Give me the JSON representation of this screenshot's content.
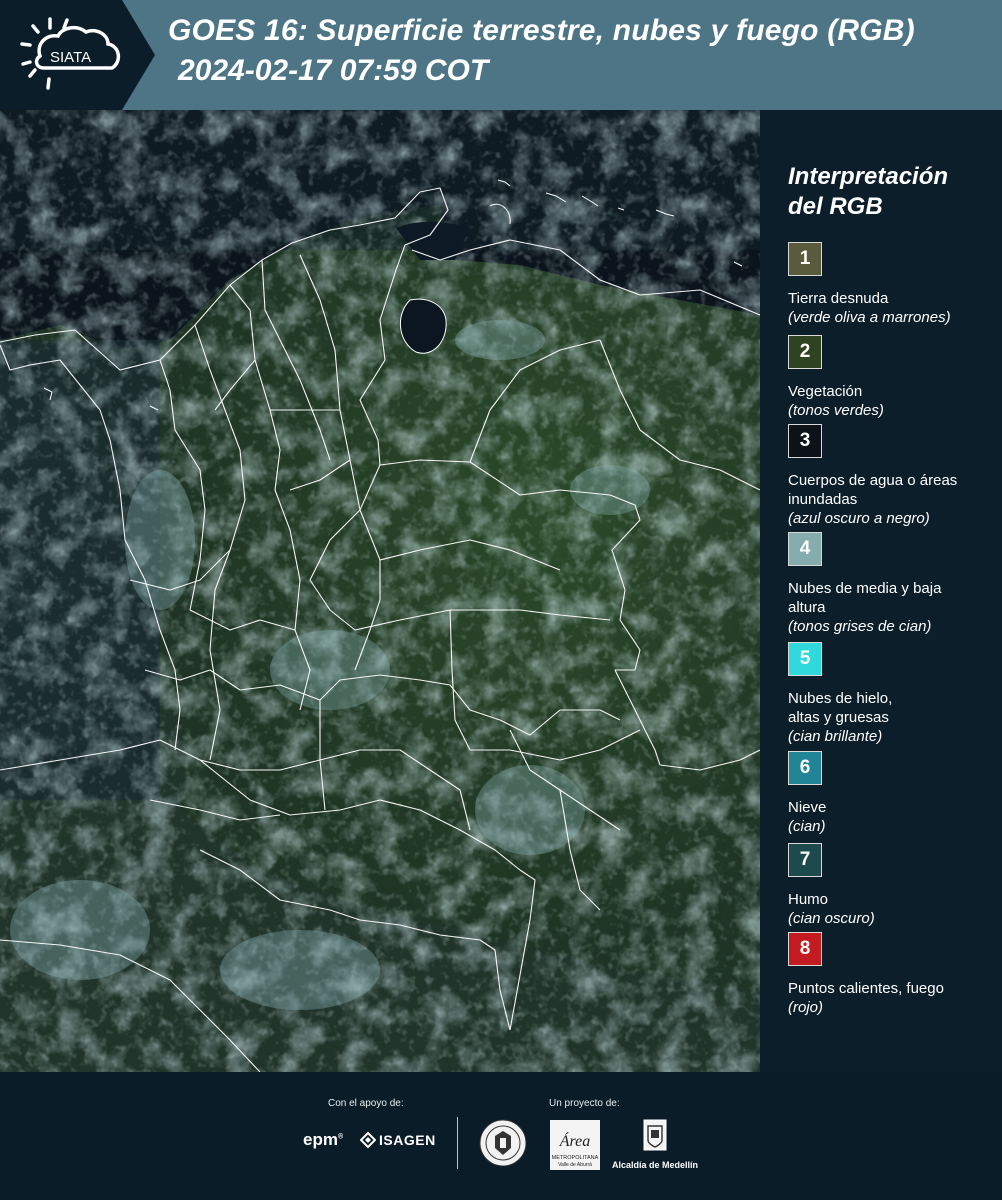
{
  "header": {
    "logo_text": "SIATA",
    "title": "GOES 16: Superficie terrestre, nubes y fuego (RGB)",
    "timestamp": "2024-02-17 07:59 COT"
  },
  "legend": {
    "title": "Interpretación del RGB",
    "items": [
      {
        "number": "1",
        "color": "#5a5b3c",
        "label": "Tierra desnuda",
        "note": "(verde oliva a marrones)"
      },
      {
        "number": "2",
        "color": "#2f4321",
        "label": "Vegetación",
        "note": "(tonos verdes)"
      },
      {
        "number": "3",
        "color": "#0c1218",
        "label": "Cuerpos de agua o áreas inundadas",
        "note": "(azul oscuro a negro)"
      },
      {
        "number": "4",
        "color": "#86adad",
        "label": "Nubes de media y baja altura",
        "note": "(tonos grises de cian)"
      },
      {
        "number": "5",
        "color": "#2fd9dc",
        "label": "Nubes de hielo, altas y gruesas",
        "note": "(cian brillante)"
      },
      {
        "number": "6",
        "color": "#228596",
        "label": "Nieve",
        "note": "(cian)"
      },
      {
        "number": "7",
        "color": "#1e4a4e",
        "label": "Humo",
        "note": "(cian oscuro)"
      },
      {
        "number": "8",
        "color": "#c31b1f",
        "label": "Puntos calientes, fuego",
        "note": "(rojo)"
      }
    ]
  },
  "footer": {
    "support_label": "Con el apoyo de:",
    "project_label": "Un proyecto de:",
    "epm": "epm",
    "isagen": "ISAGEN",
    "area_text": "Área",
    "area_sub1": "METROPOLITANA",
    "area_sub2": "Valle de Aburrá",
    "alcaldia": "Alcaldía de Medellín"
  }
}
